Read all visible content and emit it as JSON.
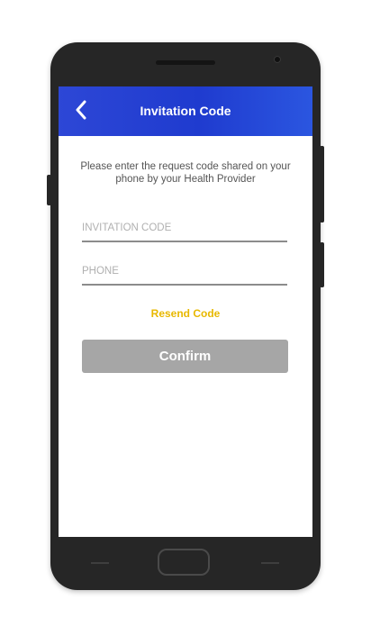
{
  "header": {
    "title": "Invitation Code",
    "back_icon": "chevron-left-icon"
  },
  "form": {
    "instructions": "Please enter the request code shared on your phone by your Health Provider",
    "invitation_code_placeholder": "INVITATION CODE",
    "invitation_code_value": "",
    "phone_placeholder": "PHONE",
    "phone_value": "",
    "resend_label": "Resend Code",
    "confirm_label": "Confirm"
  },
  "colors": {
    "header_gradient_start": "#2d47d6",
    "header_gradient_end": "#2b56e0",
    "accent_link": "#e8b800",
    "button_disabled": "#a6a6a6",
    "device_body": "#262626"
  }
}
